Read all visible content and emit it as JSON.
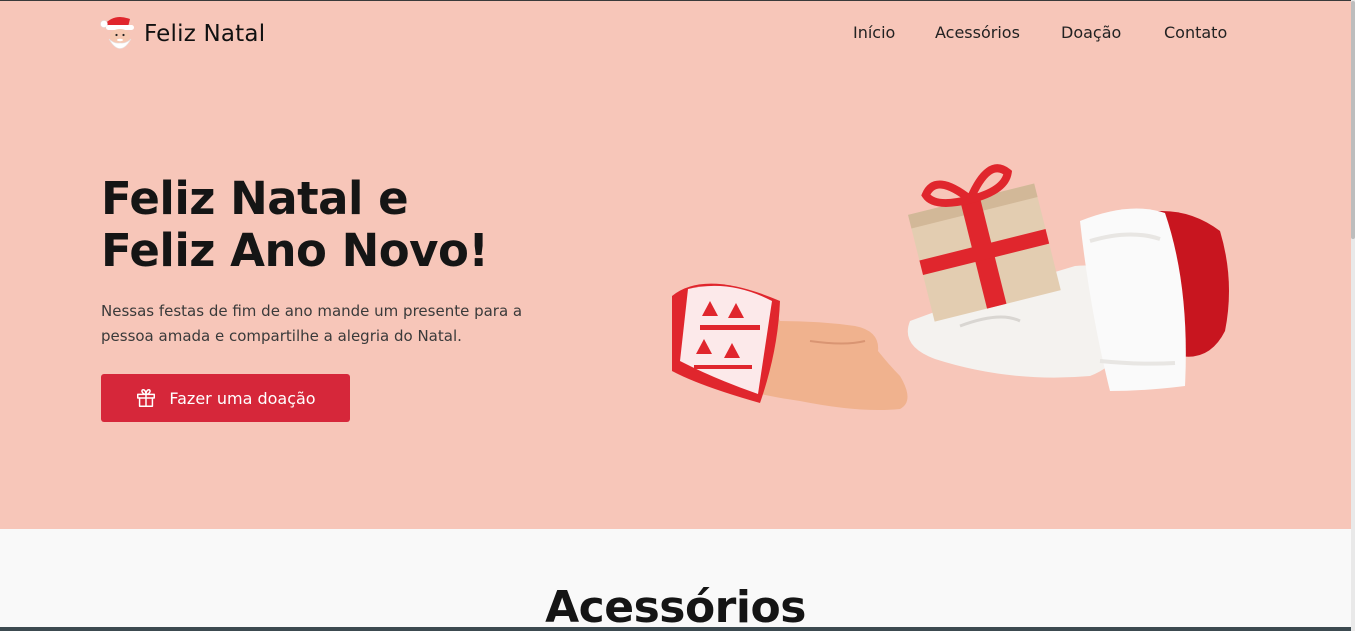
{
  "header": {
    "brand": "Feliz Natal",
    "logo_icon": "santa-icon"
  },
  "nav": {
    "items": [
      {
        "label": "Início"
      },
      {
        "label": "Acessórios"
      },
      {
        "label": "Doação"
      },
      {
        "label": "Contato"
      }
    ]
  },
  "hero": {
    "title_line1": "Feliz Natal e",
    "title_line2": "Feliz Ano Novo!",
    "description": "Nessas festas de fim de ano mande um presente para a pessoa amada e compartilhe a alegria do Natal.",
    "cta_label": "Fazer uma doação",
    "cta_icon": "gift-icon",
    "illustration": "hands-giving-gift-illustration"
  },
  "accessories": {
    "title": "Acessórios"
  },
  "colors": {
    "hero_bg": "#f7c6b9",
    "accent": "#d6273a",
    "text": "#151515",
    "page_bg": "#f9f9f9"
  }
}
